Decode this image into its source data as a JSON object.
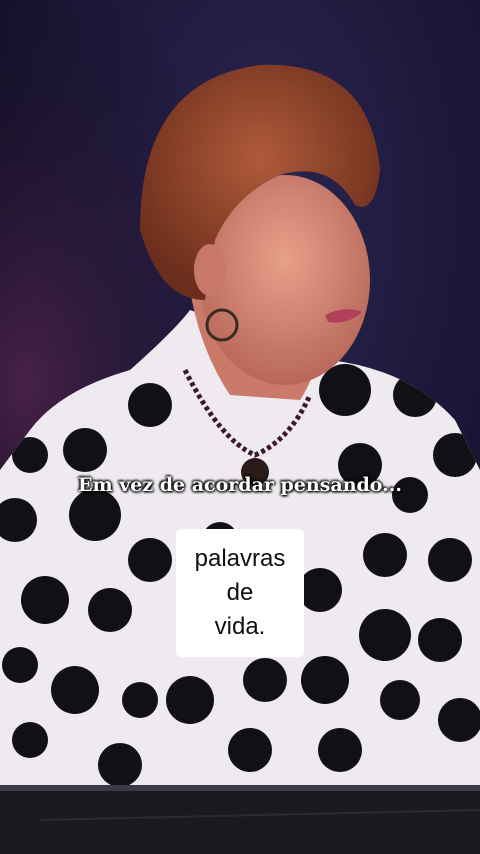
{
  "video": {
    "caption_top": "Em vez de acordar pensando...",
    "caption_box_lines": [
      "palavras",
      "de",
      "vida."
    ]
  }
}
